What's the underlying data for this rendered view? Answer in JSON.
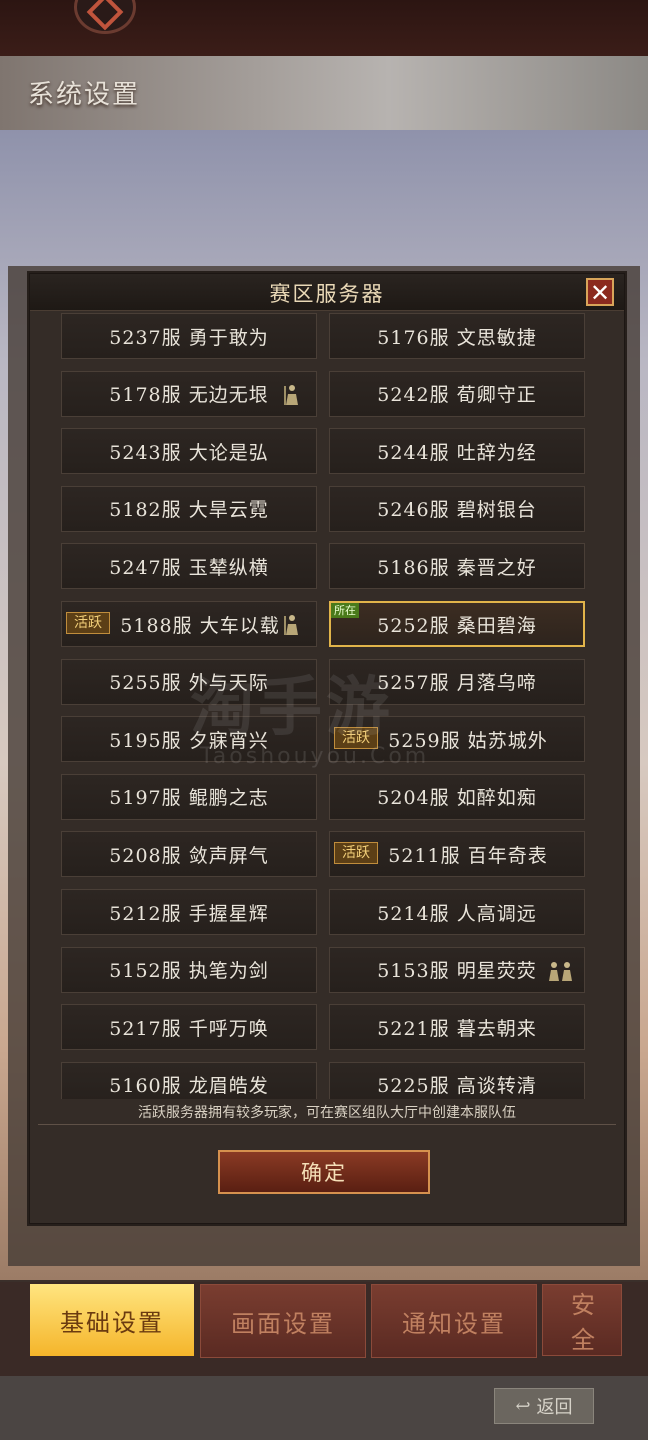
{
  "background": {
    "page_title": "系统设置",
    "tabs": [
      {
        "label": "基础设置",
        "active": true
      },
      {
        "label": "画面设置",
        "active": false
      },
      {
        "label": "通知设置",
        "active": false
      },
      {
        "label": "安全",
        "active": false
      }
    ],
    "back_label": "返回"
  },
  "modal": {
    "title": "赛区服务器",
    "close_icon": "close-icon",
    "servers": [
      {
        "name": "5237服 勇于敢为"
      },
      {
        "name": "5176服 文思敏捷"
      },
      {
        "name": "5178服 无边无垠",
        "icon": "soldier-icon"
      },
      {
        "name": "5242服 荀卿守正"
      },
      {
        "name": "5243服 大论是弘"
      },
      {
        "name": "5244服 吐辞为经"
      },
      {
        "name": "5182服 大旱云霓"
      },
      {
        "name": "5246服 碧树银台"
      },
      {
        "name": "5247服 玉辇纵横"
      },
      {
        "name": "5186服 秦晋之好"
      },
      {
        "name": "5188服 大车以载",
        "badge": "活跃",
        "icon": "soldier-icon"
      },
      {
        "name": "5252服 桑田碧海",
        "tag": "所在",
        "selected": true
      },
      {
        "name": "5255服 外与天际"
      },
      {
        "name": "5257服 月落乌啼"
      },
      {
        "name": "5195服 夕寐宵兴"
      },
      {
        "name": "5259服 姑苏城外",
        "badge": "活跃"
      },
      {
        "name": "5197服 鲲鹏之志"
      },
      {
        "name": "5204服 如醉如痴"
      },
      {
        "name": "5208服 敛声屏气"
      },
      {
        "name": "5211服 百年奇表",
        "badge": "活跃"
      },
      {
        "name": "5212服 手握星辉"
      },
      {
        "name": "5214服 人高调远"
      },
      {
        "name": "5152服 执笔为剑"
      },
      {
        "name": "5153服 明星荧荧",
        "icon": "soldiers-icon"
      },
      {
        "name": "5217服 千呼万唤"
      },
      {
        "name": "5221服 暮去朝来"
      },
      {
        "name": "5160服 龙眉皓发"
      },
      {
        "name": "5225服 高谈转清"
      }
    ],
    "note": "活跃服务器拥有较多玩家，可在赛区组队大厅中创建本服队伍",
    "confirm_label": "确定"
  },
  "watermark": {
    "main": "淘手游",
    "sub": "Taoshouyou.Com"
  }
}
